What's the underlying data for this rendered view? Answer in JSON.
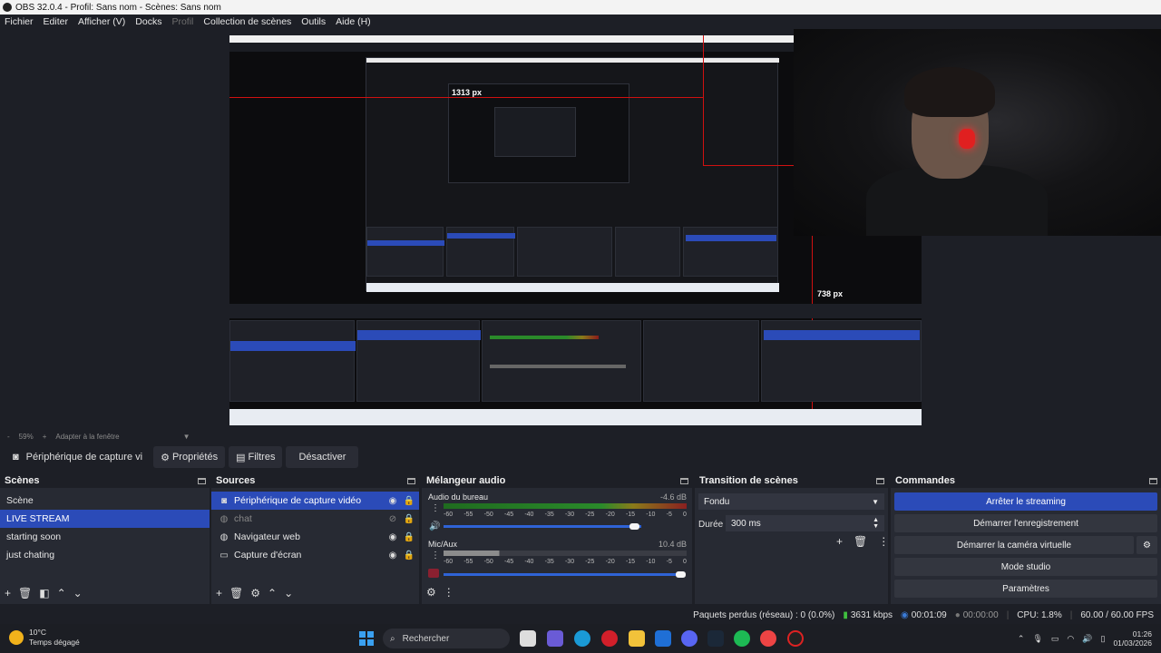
{
  "window": {
    "title": "OBS 32.0.4 - Profil: Sans nom - Scènes: Sans nom"
  },
  "menu": [
    "Fichier",
    "Editer",
    "Afficher (V)",
    "Docks",
    "Profil",
    "Collection de scènes",
    "Outils",
    "Aide (H)"
  ],
  "preview": {
    "measure_h": "1313 px",
    "measure_v": "738 px"
  },
  "zoom": {
    "minus": "-",
    "value": "59%",
    "plus": "+",
    "fit_label": "Adapter à la fenêtre"
  },
  "source_toolbar": {
    "source_name": "Périphérique de capture vi",
    "properties": "Propriétés",
    "filters": "Filtres",
    "disable": "Désactiver"
  },
  "scenes": {
    "title": "Scènes",
    "items": [
      "Scène",
      "LIVE STREAM",
      "starting soon",
      "just chating"
    ],
    "selected": 1
  },
  "sources": {
    "title": "Sources",
    "items": [
      {
        "name": "Périphérique de capture vidéo",
        "icon": "camera-icon",
        "selected": true,
        "visible": true
      },
      {
        "name": "chat",
        "icon": "globe-icon",
        "selected": false,
        "visible": false
      },
      {
        "name": "Navigateur web",
        "icon": "globe-icon",
        "selected": false,
        "visible": true
      },
      {
        "name": "Capture d'écran",
        "icon": "monitor-icon",
        "selected": false,
        "visible": true
      }
    ]
  },
  "mixer": {
    "title": "Mélangeur audio",
    "channels": [
      {
        "name": "Audio du bureau",
        "db": "-4.6 dB",
        "level": 0.95
      },
      {
        "name": "Mic/Aux",
        "db": "10.4 dB",
        "level": 1.0
      }
    ],
    "ticks": [
      "-60",
      "-55",
      "-50",
      "-45",
      "-40",
      "-35",
      "-30",
      "-25",
      "-20",
      "-15",
      "-10",
      "-5",
      "0"
    ]
  },
  "transition": {
    "title": "Transition de scènes",
    "selected": "Fondu",
    "duration_label": "Durée",
    "duration_value": "300 ms"
  },
  "commands": {
    "title": "Commandes",
    "buttons": [
      "Arrêter le streaming",
      "Démarrer l'enregistrement",
      "Démarrer la caméra virtuelle",
      "Mode studio",
      "Paramètres"
    ]
  },
  "status": {
    "dropped": "Paquets perdus (réseau) : 0 (0.0%)",
    "bitrate": "3631 kbps",
    "stream_time": "00:01:09",
    "rec_time": "00:00:00",
    "cpu": "CPU: 1.8%",
    "fps": "60.00 / 60.00 FPS"
  },
  "taskbar": {
    "weather_temp": "10°C",
    "weather_desc": "Temps dégagé",
    "search_placeholder": "Rechercher",
    "time": "01:26",
    "date": "01/03/2026"
  },
  "colors": {
    "accent": "#2b4bb8",
    "panel": "#272a33",
    "bg": "#1d1f26"
  }
}
